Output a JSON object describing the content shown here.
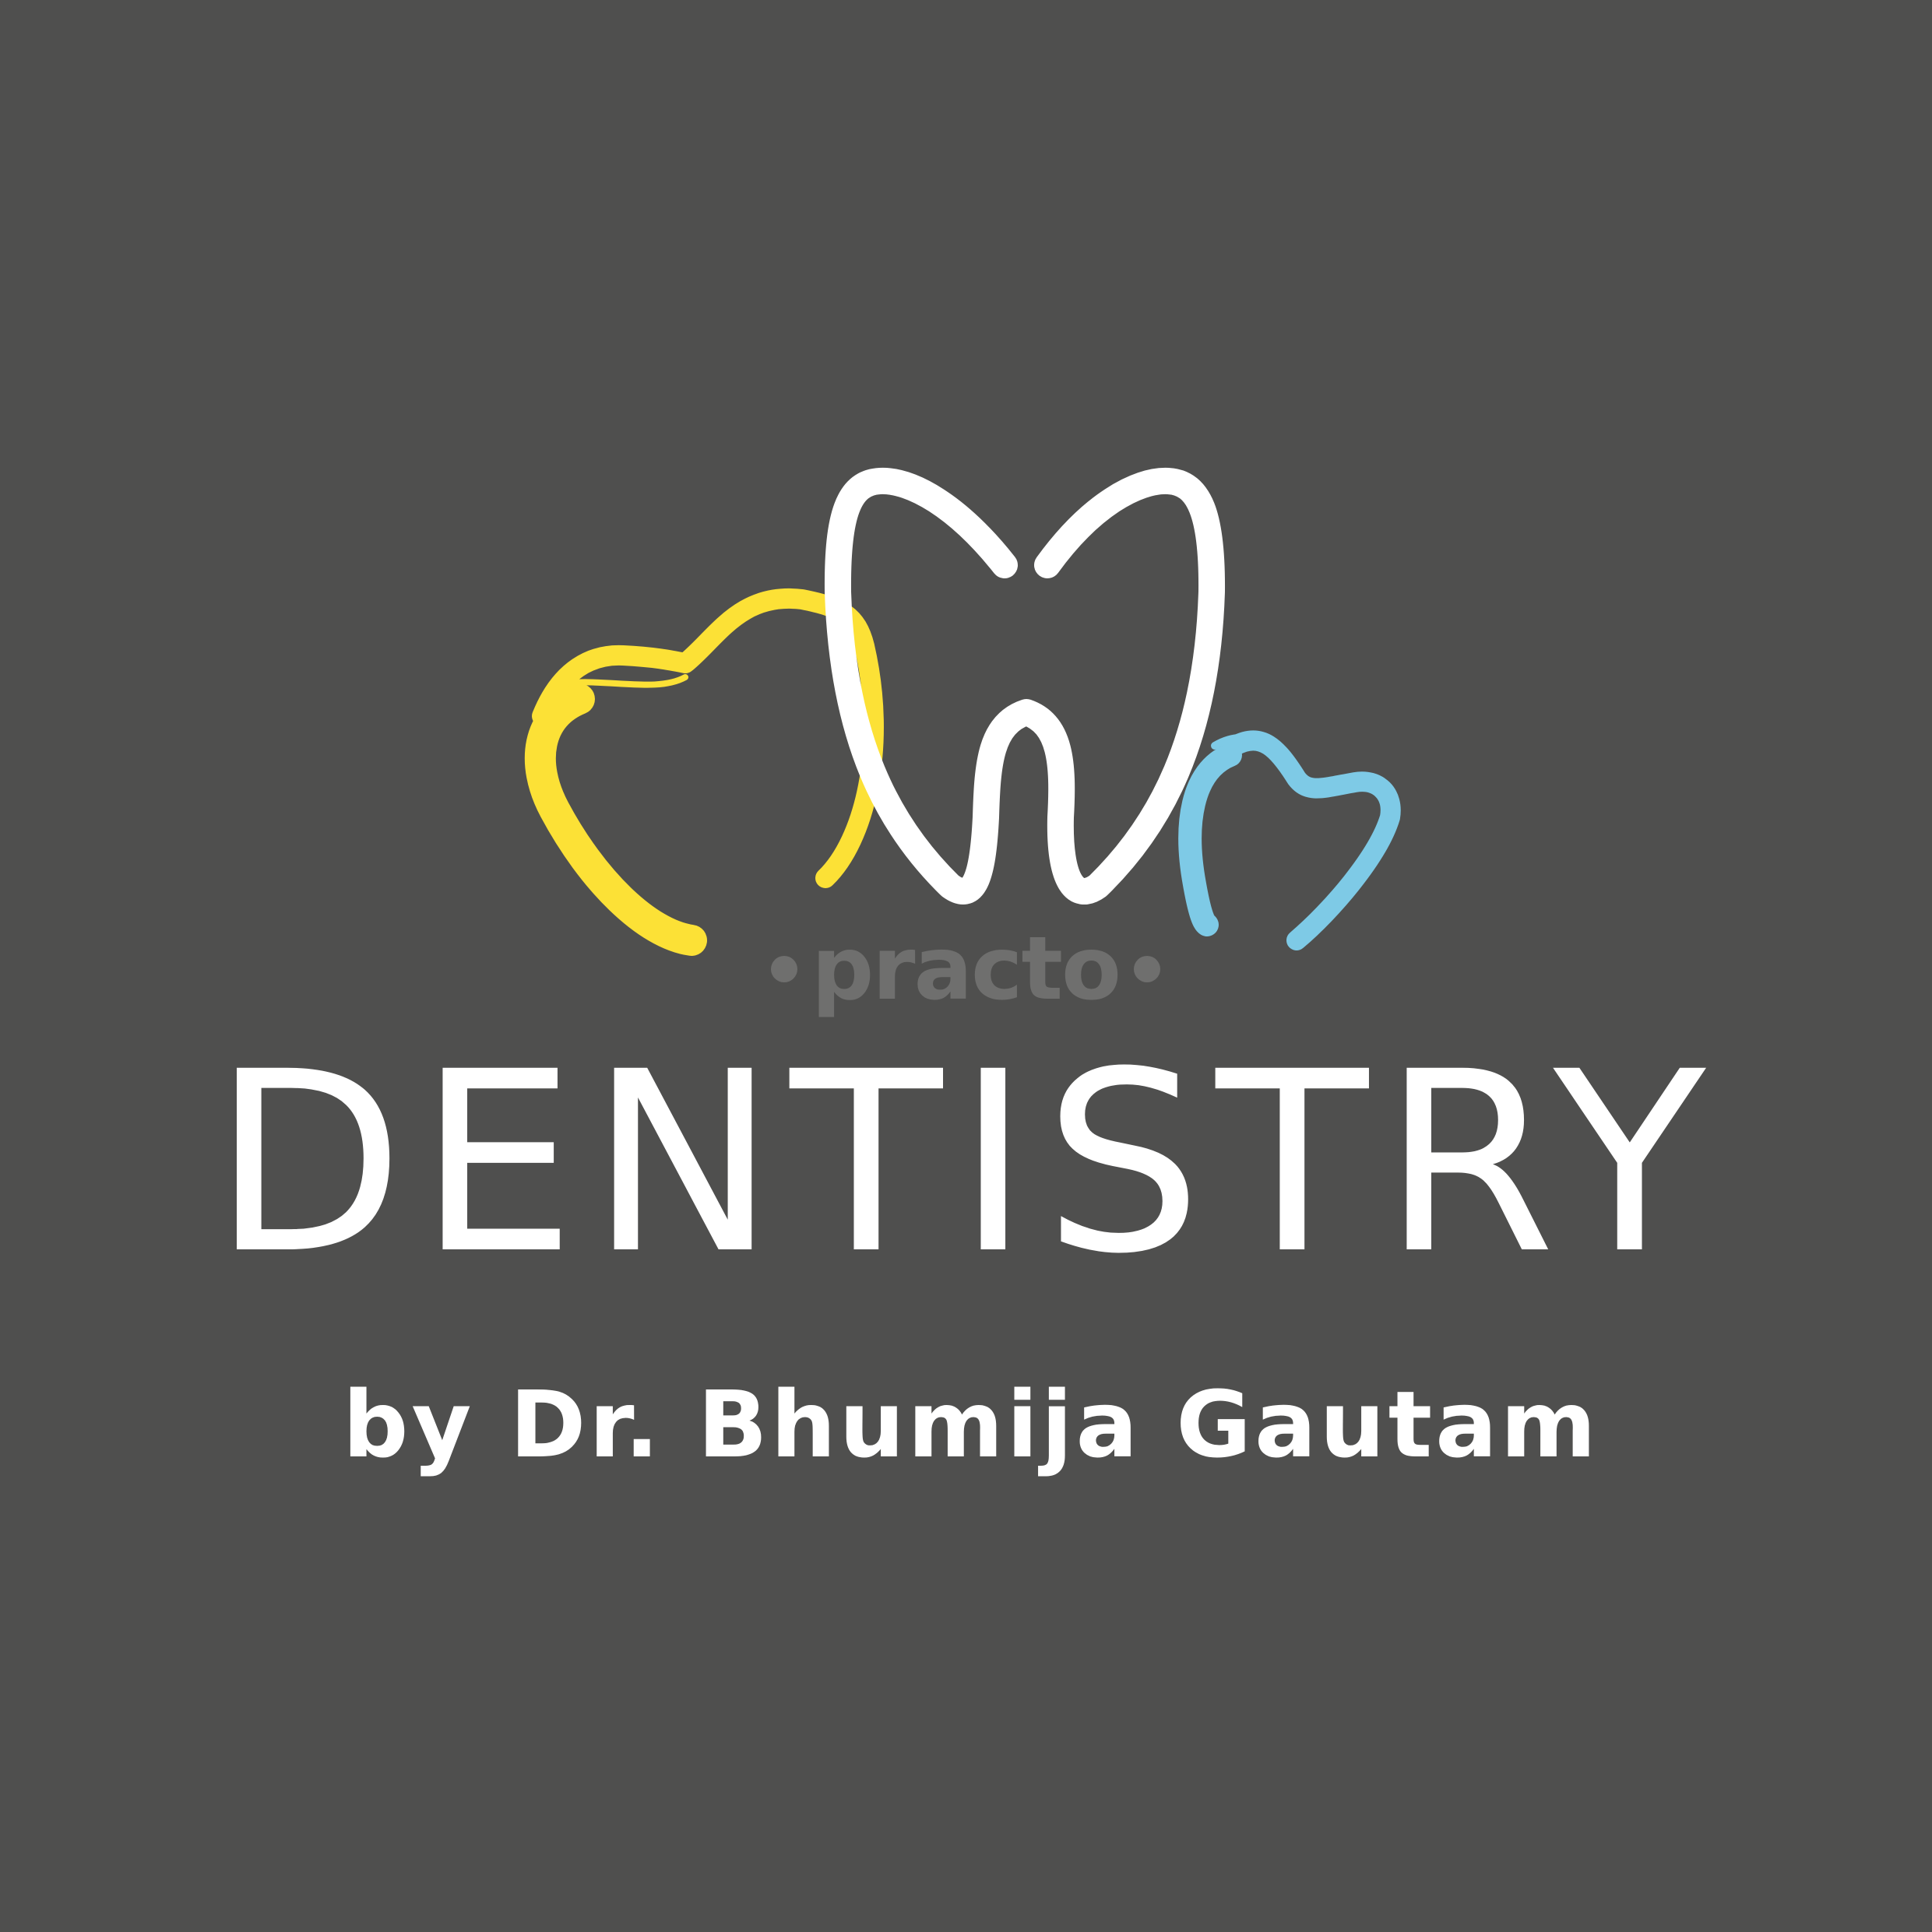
{
  "brand": {
    "title": "DENTISTRY",
    "subtitle": "by Dr. Bhumija Gautam"
  },
  "watermark": {
    "text": "practo"
  },
  "icons": {
    "logo": "teeth-logo-icon",
    "yellow_tooth": "yellow-tooth-outline-icon",
    "white_tooth": "white-tooth-outline-icon",
    "blue_tooth": "blue-tooth-outline-icon"
  },
  "colors": {
    "background": "#4f4f4e",
    "text": "#ffffff",
    "yellow": "#fce136",
    "white": "#ffffff",
    "blue": "#7ecae6",
    "watermark": "#6f6f6e"
  }
}
